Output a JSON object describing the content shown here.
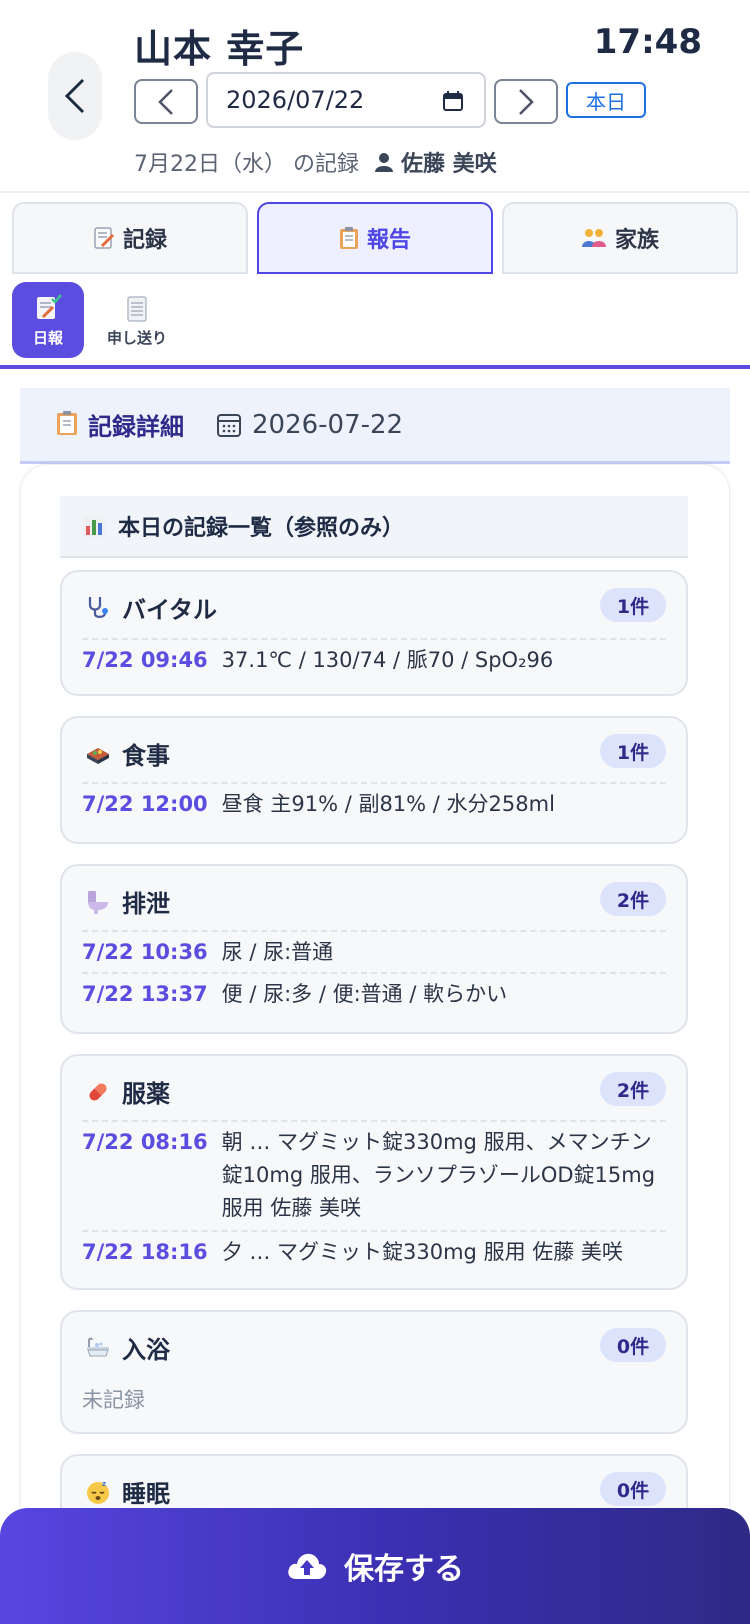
{
  "header": {
    "name": "山本 幸子",
    "clock": "17:48",
    "date_value": "2026/07/22",
    "today_label": "本日",
    "record_label": "7月22日（水） の記録",
    "staff": "佐藤 美咲"
  },
  "tabs": [
    {
      "label": "記録",
      "icon": "memo-icon"
    },
    {
      "label": "報告",
      "icon": "clipboard-icon"
    },
    {
      "label": "家族",
      "icon": "family-icon"
    }
  ],
  "subtabs": [
    {
      "label": "日報",
      "icon": "daily-report-icon"
    },
    {
      "label": "申し送り",
      "icon": "notepad-icon"
    }
  ],
  "detail": {
    "title": "記録詳細",
    "date": "2026-07-22"
  },
  "summary_title": "本日の記録一覧（参照のみ）",
  "sections": {
    "vital": {
      "title": "バイタル",
      "badge": "1件",
      "rows": [
        {
          "time": "7/22 09:46",
          "detail": "37.1℃ / 130/74 / 脈70 / SpO₂96"
        }
      ]
    },
    "meal": {
      "title": "食事",
      "badge": "1件",
      "rows": [
        {
          "time": "7/22 12:00",
          "detail": "昼食 主91% / 副81% / 水分258ml"
        }
      ]
    },
    "excretion": {
      "title": "排泄",
      "badge": "2件",
      "rows": [
        {
          "time": "7/22 10:36",
          "detail": "尿 / 尿:普通"
        },
        {
          "time": "7/22 13:37",
          "detail": "便 / 尿:多 / 便:普通 / 軟らかい"
        }
      ]
    },
    "medication": {
      "title": "服薬",
      "badge": "2件",
      "rows": [
        {
          "time": "7/22 08:16",
          "detail": "朝 … マグミット錠330mg 服用、メマンチン錠10mg 服用、ランソプラゾールOD錠15mg 服用 佐藤 美咲"
        },
        {
          "time": "7/22 18:16",
          "detail": "夕 … マグミット錠330mg 服用 佐藤 美咲"
        }
      ]
    },
    "bath": {
      "title": "入浴",
      "badge": "0件",
      "empty": "未記録"
    },
    "sleep": {
      "title": "睡眠",
      "badge": "0件"
    }
  },
  "save_label": "保存する",
  "colors": {
    "accent": "#5a4de0",
    "link_blue": "#1e6fe0",
    "badge_bg": "#dde3fb"
  }
}
